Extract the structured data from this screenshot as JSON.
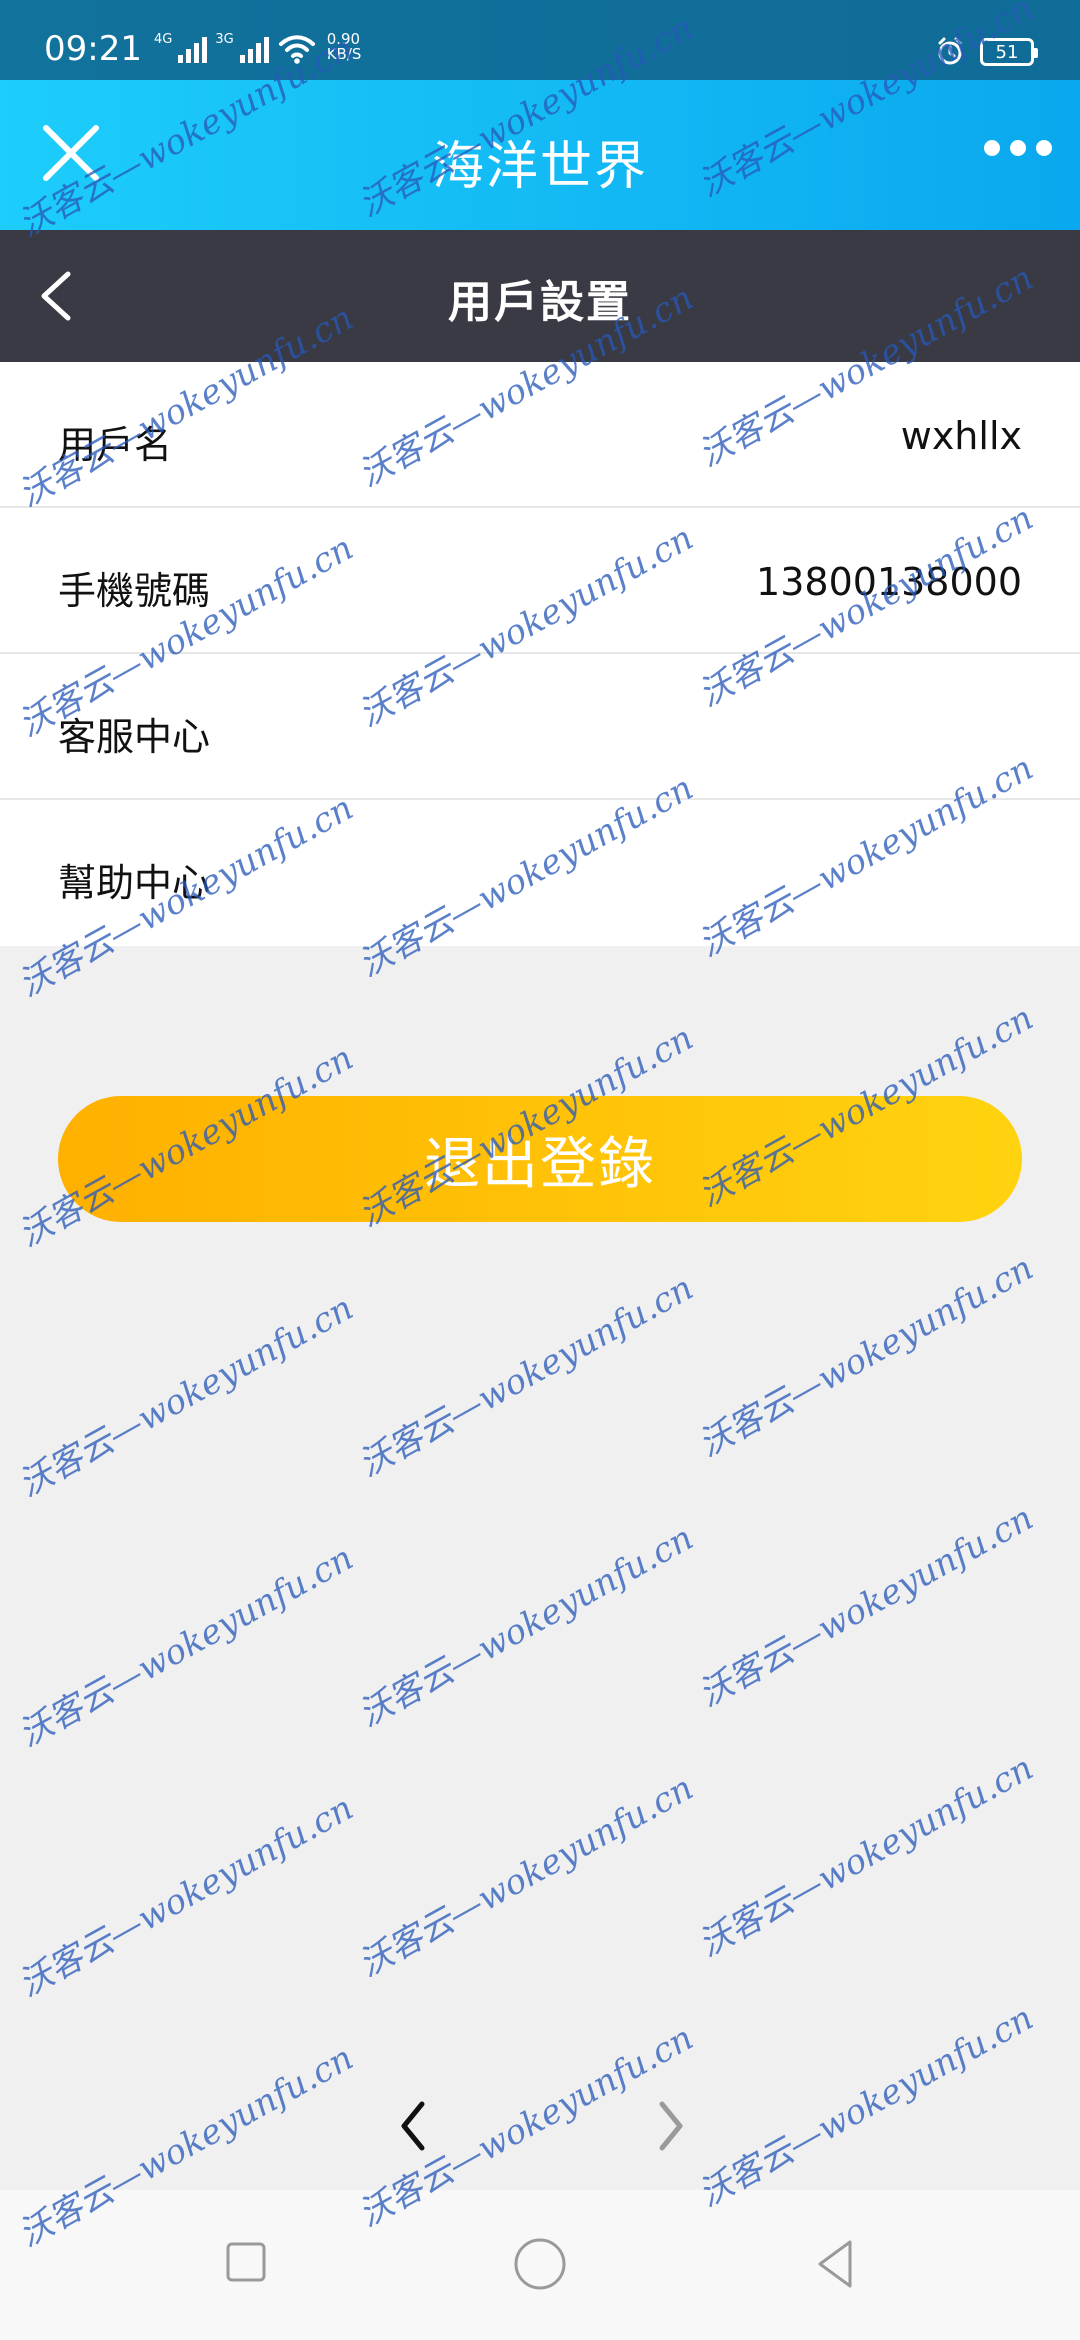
{
  "status_bar": {
    "time": "09:21",
    "network_1": "4G",
    "network_2": "3G",
    "speed_value": "0.90",
    "speed_unit": "KB/S",
    "battery": "51"
  },
  "app_header": {
    "title": "海洋世界"
  },
  "page_nav": {
    "title": "用戶設置"
  },
  "settings": [
    {
      "label": "用戶名",
      "value": "wxhllx"
    },
    {
      "label": "手機號碼",
      "value": "13800138000"
    },
    {
      "label": "客服中心",
      "value": ""
    },
    {
      "label": "幫助中心",
      "value": ""
    }
  ],
  "logout": {
    "label": "退出登錄"
  },
  "watermark": {
    "text": "沃客云—wokeyunfu.cn"
  },
  "colors": {
    "header_gradient_start": "#1dcdfb",
    "header_gradient_end": "#0aa8ee",
    "nav_bar": "#393a43",
    "logout_gradient_start": "#ffb000",
    "logout_gradient_end": "#ffd30f",
    "watermark": "#2858b9"
  },
  "icons": {
    "app_close": "close-icon",
    "app_more": "more-icon",
    "page_back": "chevron-left-icon",
    "browser_back": "chevron-left-icon",
    "browser_forward": "chevron-right-icon",
    "system_recent": "square-icon",
    "system_home": "circle-icon",
    "system_back": "triangle-icon"
  }
}
